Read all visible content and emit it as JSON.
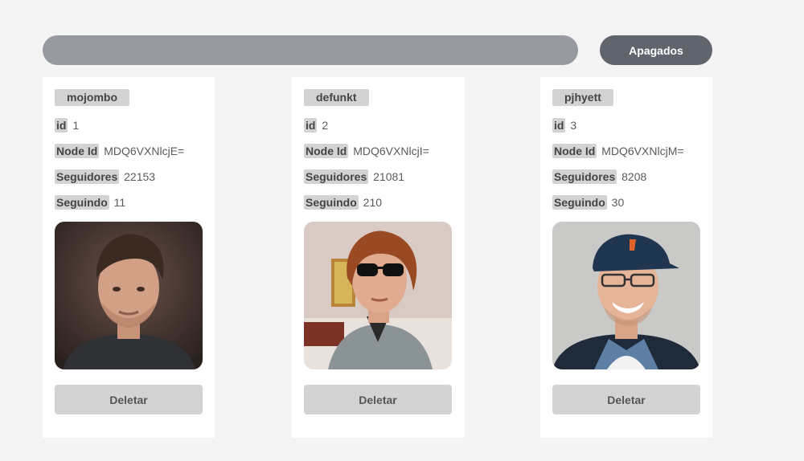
{
  "header": {
    "toggle_label": "Apagados"
  },
  "users": [
    {
      "login": "mojombo",
      "id_label": "id",
      "id": "1",
      "node_id_label": "Node Id",
      "node_id": "MDQ6VXNlcjE=",
      "followers_label": "Seguidores",
      "followers": "22153",
      "following_label": "Seguindo",
      "following": "11",
      "delete_label": "Deletar"
    },
    {
      "login": "defunkt",
      "id_label": "id",
      "id": "2",
      "node_id_label": "Node Id",
      "node_id": "MDQ6VXNlcjI=",
      "followers_label": "Seguidores",
      "followers": "21081",
      "following_label": "Seguindo",
      "following": "210",
      "delete_label": "Deletar"
    },
    {
      "login": "pjhyett",
      "id_label": "id",
      "id": "3",
      "node_id_label": "Node Id",
      "node_id": "MDQ6VXNlcjM=",
      "followers_label": "Seguidores",
      "followers": "8208",
      "following_label": "Seguindo",
      "following": "30",
      "delete_label": "Deletar"
    }
  ],
  "colors": {
    "background": "#f4f4f4",
    "search_bar": "#979aa0",
    "toggle_button": "#60646d",
    "tag": "#d3d3d3",
    "card": "#ffffff"
  }
}
